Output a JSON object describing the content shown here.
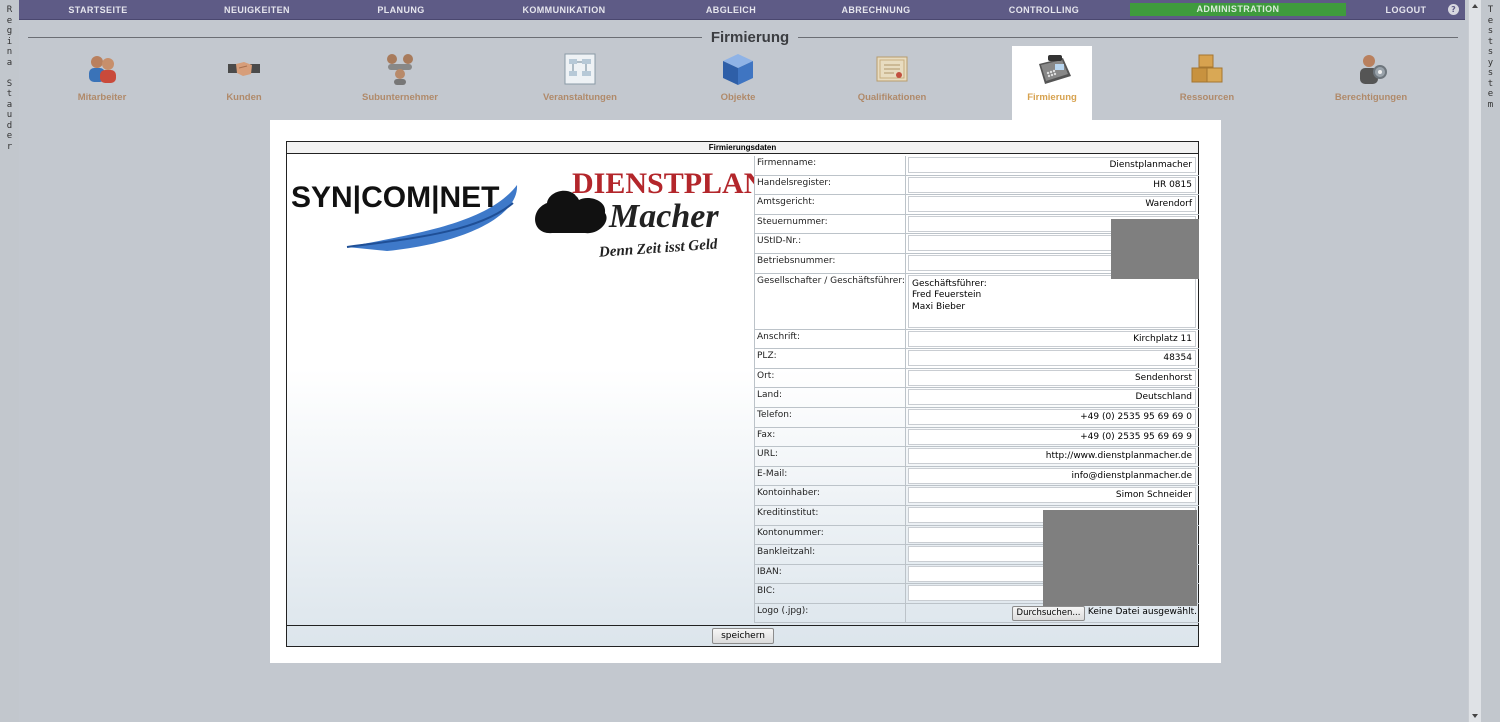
{
  "side_left": [
    "R",
    "e",
    "g",
    "i",
    "n",
    "a",
    "",
    "S",
    "t",
    "a",
    "u",
    "d",
    "e",
    "r"
  ],
  "side_right": [
    "T",
    "e",
    "s",
    "t",
    "s",
    "y",
    "s",
    "t",
    "e",
    "m"
  ],
  "nav": {
    "items": [
      "STARTSEITE",
      "NEUIGKEITEN",
      "PLANUNG",
      "KOMMUNIKATION",
      "ABGLEICH",
      "ABRECHNUNG",
      "CONTROLLING",
      "ADMINISTRATION",
      "LOGOUT"
    ],
    "active": "ADMINISTRATION",
    "help_icon": "help-icon",
    "accent": "#5e5b86",
    "active_color": "#3f9b3d"
  },
  "page_title": "Firmierung",
  "categories": [
    "Mitarbeiter",
    "Kunden",
    "Subunternehmer",
    "Veranstaltungen",
    "Objekte",
    "Qualifikationen",
    "Firmierung",
    "Ressourcen",
    "Berechtigungen"
  ],
  "category_icons": [
    "people-icon",
    "handshake-icon",
    "network-people-icon",
    "diagram-icon",
    "cube-icon",
    "certificate-icon",
    "telephone-icon",
    "boxes-icon",
    "user-gear-icon"
  ],
  "form": {
    "header": "Firmierungsdaten",
    "logos": {
      "syncomnet": "SYN|COM|NET",
      "dienstplan": "DIENSTPLAN",
      "macher": "Macher",
      "slogan": "Denn Zeit isst Geld"
    },
    "fields": [
      {
        "label": "Firmenname:",
        "value": "Dienstplanmacher"
      },
      {
        "label": "Handelsregister:",
        "value": "HR 0815"
      },
      {
        "label": "Amtsgericht:",
        "value": "Warendorf"
      },
      {
        "label": "Steuernummer:",
        "value": ""
      },
      {
        "label": "UStID-Nr.:",
        "value": ""
      },
      {
        "label": "Betriebsnummer:",
        "value": ""
      },
      {
        "label": "Gesellschafter / Geschäftsführer:",
        "value": "Geschäftsführer:\nFred Feuerstein\nMaxi Bieber"
      },
      {
        "label": "Anschrift:",
        "value": "Kirchplatz 11"
      },
      {
        "label": "PLZ:",
        "value": "48354"
      },
      {
        "label": "Ort:",
        "value": "Sendenhorst"
      },
      {
        "label": "Land:",
        "value": "Deutschland"
      },
      {
        "label": "Telefon:",
        "value": "+49 (0) 2535 95 69 69 0"
      },
      {
        "label": "Fax:",
        "value": "+49 (0) 2535 95 69 69 9"
      },
      {
        "label": "URL:",
        "value": "http://www.dienstplanmacher.de"
      },
      {
        "label": "E-Mail:",
        "value": "info@dienstplanmacher.de"
      },
      {
        "label": "Kontoinhaber:",
        "value": "Simon Schneider"
      },
      {
        "label": "Kreditinstitut:",
        "value": ""
      },
      {
        "label": "Kontonummer:",
        "value": ""
      },
      {
        "label": "Bankleitzahl:",
        "value": ""
      },
      {
        "label": "IBAN:",
        "value": ""
      },
      {
        "label": "BIC:",
        "value": ""
      }
    ],
    "logo_label": "Logo (.jpg):",
    "browse_label": "Durchsuchen...",
    "no_file": "Keine Datei ausgewählt.",
    "save_label": "speichern"
  }
}
